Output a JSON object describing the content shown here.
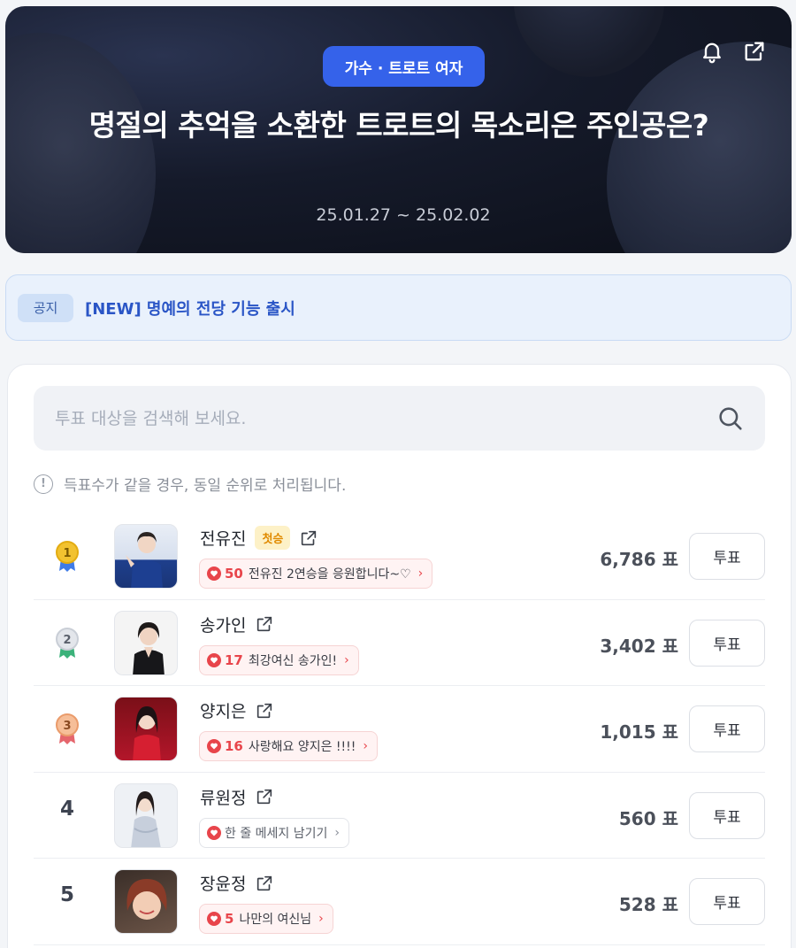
{
  "hero": {
    "category": "가수 · 트로트 여자",
    "title": "명절의 추억을 소환한 트로트의 목소리은 주인공은?",
    "date_range": "25.01.27 ~ 25.02.02",
    "icons": [
      "bell-icon",
      "share-icon"
    ]
  },
  "notice": {
    "tag": "공지",
    "text": "[NEW] 명예의 전당 기능 출시"
  },
  "search": {
    "placeholder": "투표 대상을 검색해 보세요."
  },
  "info": {
    "text": "득표수가 같을 경우, 동일 순위로 처리됩니다."
  },
  "colors": {
    "accent": "#3562ea",
    "heart": "#e8454b",
    "gold": "#f2c230",
    "silver": "#c9ced6",
    "bronze": "#f0a77a"
  },
  "rankings": [
    {
      "rank": "1",
      "name": "전유진",
      "badge": "첫승",
      "cheer_count": "50",
      "cheer_text": "전유진 2연승을 응원합니다~♡",
      "votes": "6,786 표",
      "vote_label": "투표"
    },
    {
      "rank": "2",
      "name": "송가인",
      "badge": "",
      "cheer_count": "17",
      "cheer_text": "최강여신 송가인!",
      "votes": "3,402 표",
      "vote_label": "투표"
    },
    {
      "rank": "3",
      "name": "양지은",
      "badge": "",
      "cheer_count": "16",
      "cheer_text": "사랑해요 양지은 !!!!",
      "votes": "1,015 표",
      "vote_label": "투표"
    },
    {
      "rank": "4",
      "name": "류원정",
      "badge": "",
      "cheer_count": "",
      "cheer_text": "한 줄 메세지 남기기",
      "votes": "560 표",
      "vote_label": "투표"
    },
    {
      "rank": "5",
      "name": "장윤정",
      "badge": "",
      "cheer_count": "5",
      "cheer_text": "나만의 여신님",
      "votes": "528 표",
      "vote_label": "투표"
    }
  ]
}
